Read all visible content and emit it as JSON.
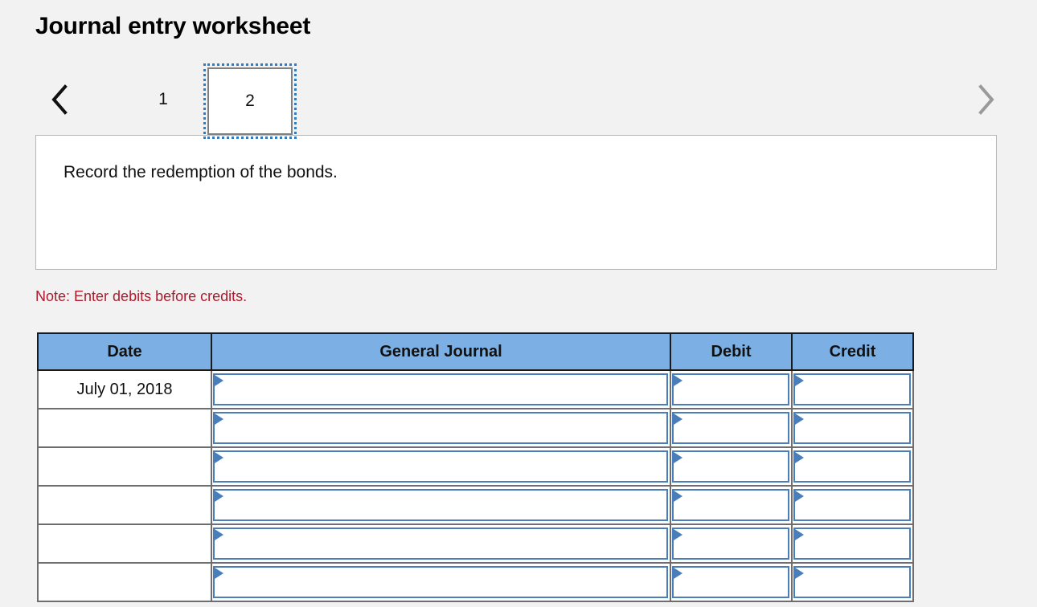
{
  "header": {
    "title": "Journal entry worksheet"
  },
  "pager": {
    "prev_icon": "chevron-left-icon",
    "next_icon": "chevron-right-icon",
    "tabs": [
      {
        "label": "1",
        "selected": false
      },
      {
        "label": "2",
        "selected": true
      }
    ]
  },
  "description": {
    "text": "Record the redemption of the bonds."
  },
  "note": {
    "text": "Note: Enter debits before credits."
  },
  "table": {
    "columns": [
      "Date",
      "General Journal",
      "Debit",
      "Credit"
    ],
    "rows": [
      {
        "date": "July 01, 2018",
        "general_journal": "",
        "debit": "",
        "credit": ""
      },
      {
        "date": "",
        "general_journal": "",
        "debit": "",
        "credit": ""
      },
      {
        "date": "",
        "general_journal": "",
        "debit": "",
        "credit": ""
      },
      {
        "date": "",
        "general_journal": "",
        "debit": "",
        "credit": ""
      },
      {
        "date": "",
        "general_journal": "",
        "debit": "",
        "credit": ""
      },
      {
        "date": "",
        "general_journal": "",
        "debit": "",
        "credit": ""
      }
    ]
  },
  "colors": {
    "page_background": "#f2f2f2",
    "header_blue": "#7cafe3",
    "input_border_blue": "#4a7ebb",
    "note_red": "#ad1b2c",
    "focus_outline_blue": "#3c78b4",
    "row_border_gray": "#6e6e6e"
  }
}
